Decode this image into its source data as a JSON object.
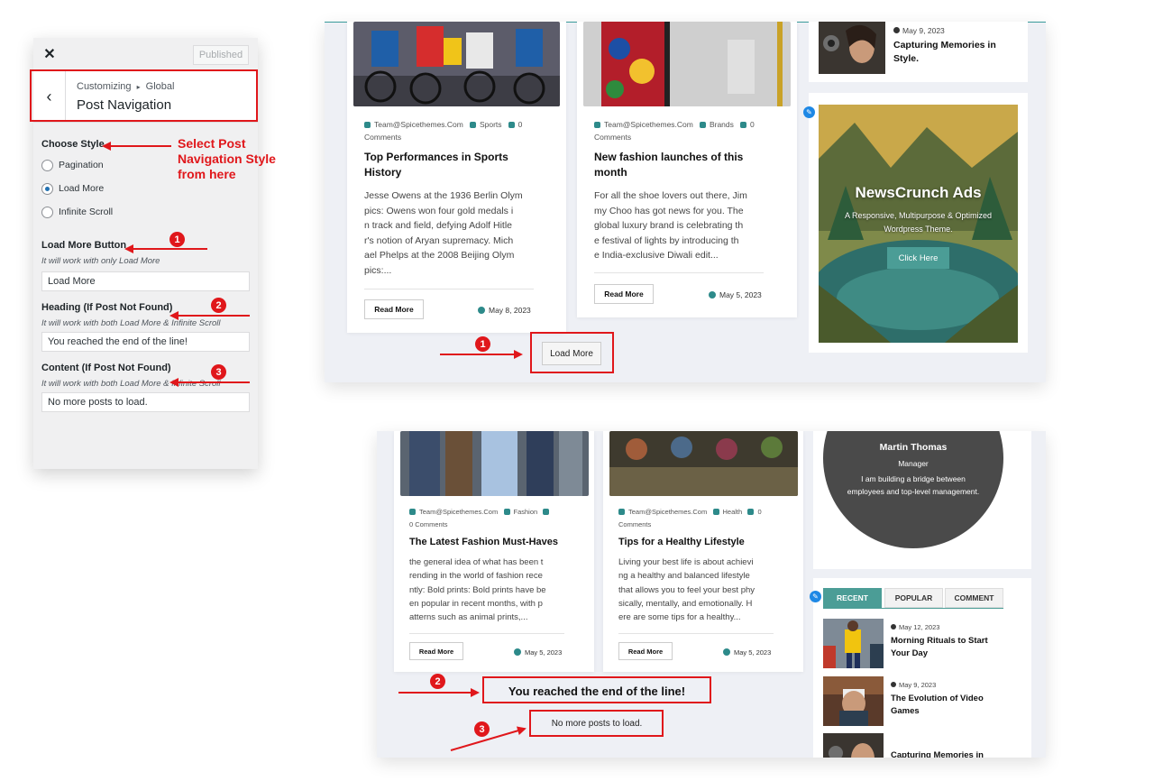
{
  "customizer": {
    "close_icon": "close-icon",
    "published_label": "Published",
    "breadcrumb_customizing": "Customizing",
    "breadcrumb_separator": "▸",
    "breadcrumb_section": "Global",
    "panel_title": "Post Navigation",
    "choose_style_label": "Choose Style",
    "style_options": [
      "Pagination",
      "Load More",
      "Infinite Scroll"
    ],
    "selected_style": "Load More",
    "load_more_button_label": "Load More Button",
    "load_more_button_note": "It will work with only Load More",
    "load_more_button_value": "Load More",
    "heading_label": "Heading (If Post Not Found)",
    "heading_note": "It will work with both Load More & Infinite Scroll",
    "heading_value": "You reached the end of the line!",
    "content_label": "Content (If Post Not Found)",
    "content_note": "It will work with both Load More & Infinite Scroll",
    "content_value": "No more posts to load."
  },
  "annotations": {
    "select_style_line1": "Select Post",
    "select_style_line2": "Navigation Style",
    "select_style_line3": "from here",
    "badge_1": "1",
    "badge_2": "2",
    "badge_3": "3",
    "accent_color": "#e0171b"
  },
  "top_shot": {
    "posts": [
      {
        "author": "Team@Spicethemes.Com",
        "category": "Sports",
        "comments_count": "0",
        "comments_word": "Comments",
        "title_line1": "Top Performances in Sports",
        "title_line2": "History",
        "excerpt_lines": [
          "Jesse Owens at the 1936 Berlin Olym",
          "pics: Owens won four gold medals i",
          "n track and field, defying Adolf Hitle",
          "r's notion of Aryan supremacy. Mich",
          "ael Phelps at the 2008 Beijing Olym",
          "pics:..."
        ],
        "read_more": "Read More",
        "date": "May 8, 2023"
      },
      {
        "author": "Team@Spicethemes.Com",
        "category": "Brands",
        "comments_count": "0",
        "comments_word": "Comments",
        "title_line1": "New fashion launches of this",
        "title_line2": "month",
        "excerpt_lines": [
          "For all the shoe lovers out there, Jim",
          "my Choo has got news for you. The",
          "global luxury brand is celebrating th",
          "e festival of lights by introducing th",
          "e India-exclusive Diwali edit..."
        ],
        "read_more": "Read More",
        "date": "May 5, 2023"
      }
    ],
    "load_more_label": "Load More",
    "sidebar_post": {
      "date": "May 9, 2023",
      "title_line1": "Capturing Memories in",
      "title_line2": "Style."
    },
    "ad": {
      "title": "NewsCrunch Ads",
      "subtitle_line1": "A Responsive, Multipurpose & Optimized",
      "subtitle_line2": "Wordpress Theme.",
      "button": "Click Here"
    }
  },
  "bottom_shot": {
    "posts": [
      {
        "author": "Team@Spicethemes.Com",
        "category": "Fashion",
        "comments_count": "0",
        "comments_word": "Comments",
        "title": "The Latest Fashion Must-Haves",
        "excerpt_lines": [
          "the general idea of what has been t",
          "rending in the world of fashion rece",
          "ntly: Bold prints: Bold prints have be",
          "en popular in recent months, with p",
          "atterns such as animal prints,..."
        ],
        "read_more": "Read More",
        "date": "May 5, 2023"
      },
      {
        "author": "Team@Spicethemes.Com",
        "category": "Health",
        "comments_count": "0",
        "comments_word": "Comments",
        "title": "Tips for a Healthy Lifestyle",
        "excerpt_lines": [
          "Living your best life is about achievi",
          "ng a healthy and balanced lifestyle",
          "that allows you to feel your best phy",
          "sically, mentally, and emotionally. H",
          "ere are some tips for a healthy..."
        ],
        "read_more": "Read More",
        "date": "May 5, 2023"
      }
    ],
    "end_heading": "You reached the end of the line!",
    "end_content": "No more posts to load.",
    "profile": {
      "name": "Martin Thomas",
      "role": "Manager",
      "bio_line1": "I am building a bridge between",
      "bio_line2": "employees and top-level management."
    },
    "tabs": [
      "RECENT",
      "POPULAR",
      "COMMENT"
    ],
    "recent_posts": [
      {
        "date": "May 12, 2023",
        "title_line1": "Morning Rituals to Start",
        "title_line2": "Your Day"
      },
      {
        "date": "May 9, 2023",
        "title_line1": "The Evolution of Video",
        "title_line2": "Games"
      },
      {
        "date": "",
        "title_line1": "Capturing Memories in",
        "title_line2": ""
      }
    ]
  }
}
